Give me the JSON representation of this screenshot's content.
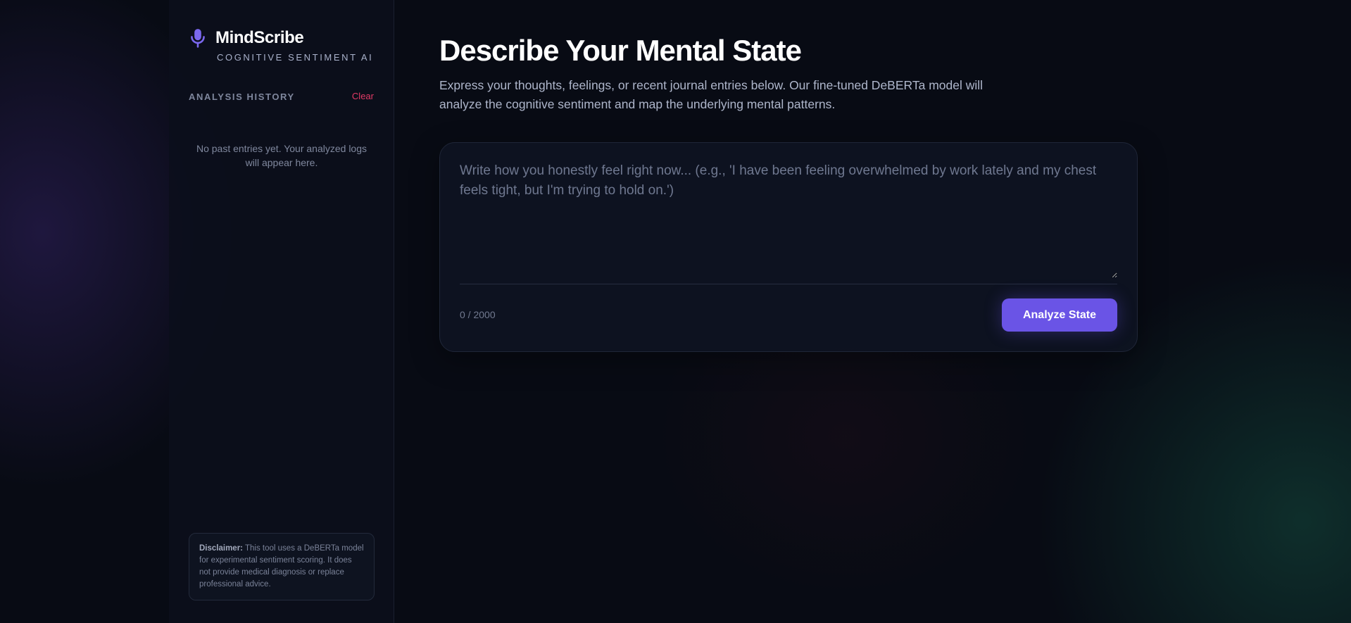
{
  "brand": {
    "name": "MindScribe",
    "tagline": "COGNITIVE SENTIMENT AI",
    "icon": "microphone-icon",
    "accent_color": "#6a54e6"
  },
  "sidebar": {
    "history_title": "ANALYSIS HISTORY",
    "clear_label": "Clear",
    "empty_message": "No past entries yet. Your analyzed logs will appear here.",
    "disclaimer_label": "Disclaimer:",
    "disclaimer_text": " This tool uses a DeBERTa model for experimental sentiment scoring. It does not provide medical diagnosis or replace professional advice."
  },
  "main": {
    "title": "Describe Your Mental State",
    "subtitle": "Express your thoughts, feelings, or recent journal entries below. Our fine-tuned DeBERTa model will analyze the cognitive sentiment and map the underlying mental patterns.",
    "input_value": "",
    "input_placeholder": "Write how you honestly feel right now... (e.g., 'I have been feeling overwhelmed by work lately and my chest feels tight, but I'm trying to hold on.')",
    "char_count": "0 / 2000",
    "analyze_label": "Analyze State"
  }
}
